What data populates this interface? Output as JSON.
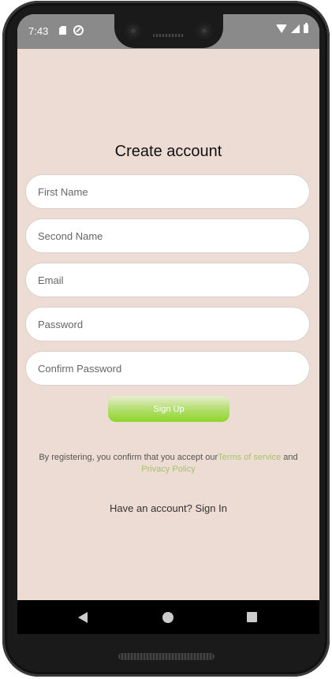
{
  "status_bar": {
    "time": "7:43",
    "left_icons": [
      "sd-card-icon",
      "sync-icon"
    ],
    "right_icons": [
      "wifi-icon",
      "signal-icon",
      "battery-icon"
    ]
  },
  "form": {
    "title": "Create account",
    "fields": {
      "first_name": {
        "placeholder": "First Name",
        "value": ""
      },
      "second_name": {
        "placeholder": "Second Name",
        "value": ""
      },
      "email": {
        "placeholder": "Email",
        "value": ""
      },
      "password": {
        "placeholder": "Password",
        "value": ""
      },
      "confirm_password": {
        "placeholder": "Confirm Password",
        "value": ""
      }
    },
    "signup_label": "Sign Up"
  },
  "terms": {
    "prefix": "By registering, you confirm that you accept our",
    "terms_link": "Terms of service",
    "conjunction": " and",
    "privacy_link": "Privacy Policy"
  },
  "signin": {
    "prompt": "Have an account? ",
    "link": "Sign In"
  },
  "nav": {
    "icons": [
      "back-icon",
      "home-icon",
      "recents-icon"
    ]
  },
  "colors": {
    "background": "#ecdcd3",
    "accent_link": "#a6c26a",
    "button_gradient_end": "#8fd42a",
    "status_bar": "#8a8a8a"
  }
}
